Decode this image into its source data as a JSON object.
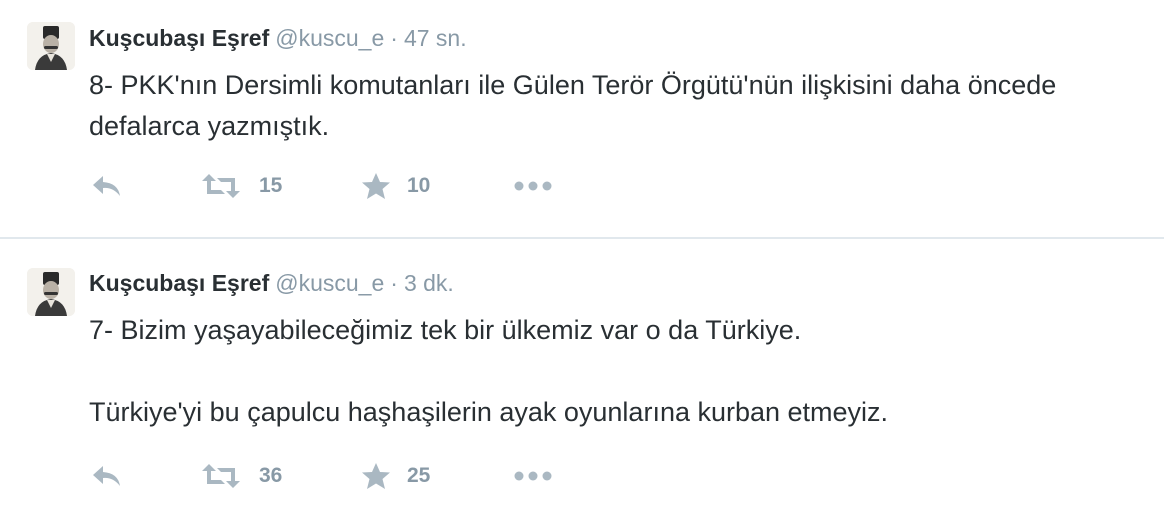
{
  "tweets": [
    {
      "fullname": "Kuşcubaşı Eşref",
      "username": "@kuscu_e",
      "separator": "·",
      "time": "47 sn.",
      "paragraphs": [
        "8- PKK'nın Dersimli komutanları ile Gülen Terör Örgütü'nün ilişkisini daha öncede defalarca yazmıştık."
      ],
      "retweets": "15",
      "favorites": "10"
    },
    {
      "fullname": "Kuşcubaşı Eşref",
      "username": "@kuscu_e",
      "separator": "·",
      "time": "3 dk.",
      "paragraphs": [
        "7- Bizim yaşayabileceğimiz tek bir ülkemiz var o da Türkiye.",
        "Türkiye'yi bu çapulcu haşhaşilerin ayak oyunlarına kurban etmeyiz."
      ],
      "retweets": "36",
      "favorites": "25"
    }
  ],
  "icons": {
    "reply": "reply-icon",
    "retweet": "retweet-icon",
    "favorite": "star-icon",
    "more": "more-dots-icon"
  },
  "colors": {
    "text": "#292f33",
    "muted": "#8899a6",
    "icon": "#aab8c2",
    "divider": "#e1e8ed"
  }
}
